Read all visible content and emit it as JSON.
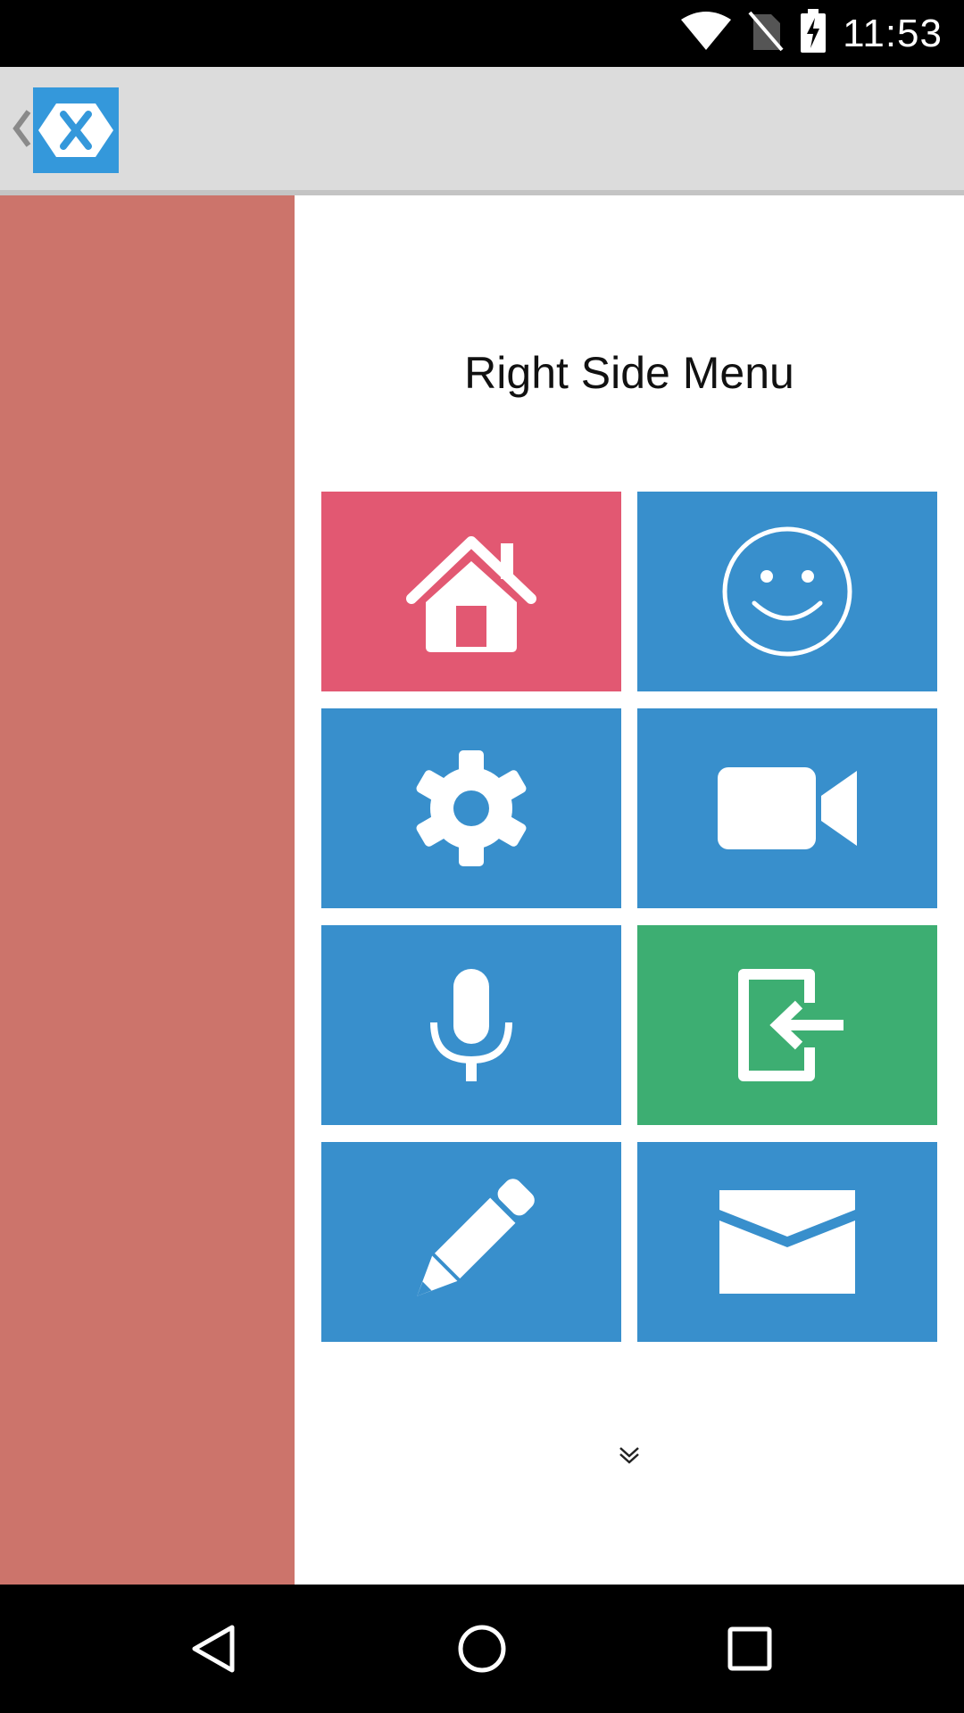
{
  "status_bar": {
    "time": "11:53",
    "icons": [
      "wifi-icon",
      "no-sim-icon",
      "battery-charging-icon"
    ]
  },
  "toolbar": {
    "back_icon": "chevron-left-icon",
    "logo_icon": "xamarin-logo-icon",
    "logo_color": "#3498db"
  },
  "left_panel": {
    "color": "#cc746b"
  },
  "menu": {
    "title": "Right Side Menu",
    "tiles": [
      {
        "icon": "home-icon",
        "color": "#e25872"
      },
      {
        "icon": "smiley-icon",
        "color": "#388fcc"
      },
      {
        "icon": "gear-icon",
        "color": "#388fcc"
      },
      {
        "icon": "video-camera-icon",
        "color": "#388fcc"
      },
      {
        "icon": "microphone-icon",
        "color": "#388fcc"
      },
      {
        "icon": "sign-in-icon",
        "color": "#3dae72"
      },
      {
        "icon": "pencil-icon",
        "color": "#388fcc"
      },
      {
        "icon": "envelope-icon",
        "color": "#388fcc"
      }
    ],
    "more_icon": "double-chevron-down-icon"
  },
  "nav_bar": {
    "buttons": [
      "back-triangle-icon",
      "home-circle-icon",
      "recents-square-icon"
    ]
  }
}
